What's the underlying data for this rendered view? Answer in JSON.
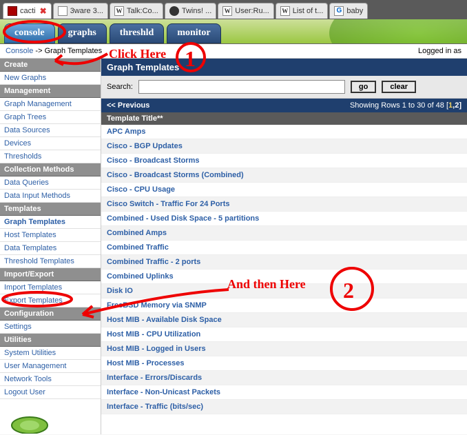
{
  "browser": {
    "tabs": [
      {
        "label": "cacti",
        "favicon": "fav-red",
        "active": true,
        "closeable": true
      },
      {
        "label": "3ware 3...",
        "favicon": "fav-doc"
      },
      {
        "label": "Talk:Co...",
        "favicon": "fav-w"
      },
      {
        "label": "Twins! ...",
        "favicon": "fav-dark"
      },
      {
        "label": "User:Ru...",
        "favicon": "fav-w"
      },
      {
        "label": "List of t...",
        "favicon": "fav-w"
      },
      {
        "label": "baby",
        "favicon": "fav-g"
      }
    ]
  },
  "app_tabs": [
    {
      "name": "console",
      "label": "console",
      "active": true
    },
    {
      "name": "graphs",
      "label": "graphs"
    },
    {
      "name": "threshld",
      "label": "threshld"
    },
    {
      "name": "monitor",
      "label": "monitor"
    }
  ],
  "breadcrumb": {
    "console": "Console",
    "sep": " -> ",
    "page": "Graph Templates"
  },
  "logged_in": "Logged in as",
  "sidebar": [
    {
      "type": "cat",
      "label": "Create"
    },
    {
      "type": "item",
      "label": "New Graphs"
    },
    {
      "type": "cat",
      "label": "Management"
    },
    {
      "type": "item",
      "label": "Graph Management"
    },
    {
      "type": "item",
      "label": "Graph Trees"
    },
    {
      "type": "item",
      "label": "Data Sources"
    },
    {
      "type": "item",
      "label": "Devices"
    },
    {
      "type": "item",
      "label": "Thresholds"
    },
    {
      "type": "cat",
      "label": "Collection Methods"
    },
    {
      "type": "item",
      "label": "Data Queries"
    },
    {
      "type": "item",
      "label": "Data Input Methods"
    },
    {
      "type": "cat",
      "label": "Templates"
    },
    {
      "type": "item",
      "label": "Graph Templates",
      "selected": true
    },
    {
      "type": "item",
      "label": "Host Templates"
    },
    {
      "type": "item",
      "label": "Data Templates"
    },
    {
      "type": "item",
      "label": "Threshold Templates"
    },
    {
      "type": "cat",
      "label": "Import/Export"
    },
    {
      "type": "item",
      "label": "Import Templates"
    },
    {
      "type": "item",
      "label": "Export Templates"
    },
    {
      "type": "cat",
      "label": "Configuration"
    },
    {
      "type": "item",
      "label": "Settings"
    },
    {
      "type": "cat",
      "label": "Utilities"
    },
    {
      "type": "item",
      "label": "System Utilities"
    },
    {
      "type": "item",
      "label": "User Management"
    },
    {
      "type": "item",
      "label": "Network Tools"
    },
    {
      "type": "item",
      "label": "Logout User"
    }
  ],
  "panel": {
    "title": "Graph Templates",
    "search_label": "Search:",
    "search_value": "",
    "go_label": "go",
    "clear_label": "clear",
    "previous_label": "<< Previous",
    "rows_text": "Showing Rows 1 to 30 of 48 [",
    "page_current": "1",
    "page_other": ",2]",
    "column_header": "Template Title**",
    "rows": [
      "APC Amps",
      "Cisco - BGP Updates",
      "Cisco - Broadcast Storms",
      "Cisco - Broadcast Storms (Combined)",
      "Cisco - CPU Usage",
      "Cisco Switch - Traffic For 24 Ports",
      "Combined - Used Disk Space - 5 partitions",
      "Combined Amps",
      "Combined Traffic",
      "Combined Traffic - 2 ports",
      "Combined Uplinks",
      "Disk IO",
      "FreeBSD Memory via SNMP",
      "Host MIB - Available Disk Space",
      "Host MIB - CPU Utilization",
      "Host MIB - Logged in Users",
      "Host MIB - Processes",
      "Interface - Errors/Discards",
      "Interface - Non-Unicast Packets",
      "Interface - Traffic (bits/sec)"
    ]
  },
  "annotations": {
    "click_here": "Click Here",
    "and_then": "And then Here"
  }
}
